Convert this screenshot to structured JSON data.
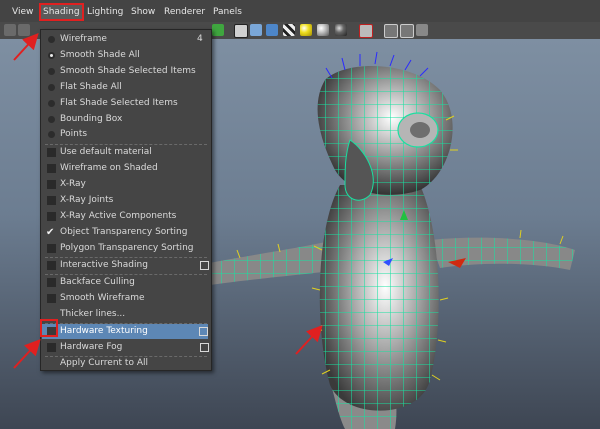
{
  "menubar": {
    "items": [
      "View",
      "Shading",
      "Lighting",
      "Show",
      "Renderer",
      "Panels"
    ]
  },
  "shading_menu": {
    "items": [
      {
        "label": "Wireframe",
        "shortcut": "4"
      },
      {
        "label": "Smooth Shade All"
      },
      {
        "label": "Smooth Shade Selected Items"
      },
      {
        "label": "Flat Shade All"
      },
      {
        "label": "Flat Shade Selected Items"
      },
      {
        "label": "Bounding Box"
      },
      {
        "label": "Points"
      },
      {
        "label": "Use default material"
      },
      {
        "label": "Wireframe on Shaded"
      },
      {
        "label": "X-Ray"
      },
      {
        "label": "X-Ray Joints"
      },
      {
        "label": "X-Ray Active Components"
      },
      {
        "label": "Object Transparency Sorting"
      },
      {
        "label": "Polygon Transparency Sorting"
      },
      {
        "label": "Interactive Shading"
      },
      {
        "label": "Backface Culling"
      },
      {
        "label": "Smooth Wireframe"
      },
      {
        "label": "Thicker lines..."
      },
      {
        "label": "Hardware Texturing"
      },
      {
        "label": "Hardware Fog"
      },
      {
        "label": "Apply Current to All"
      }
    ]
  },
  "colors": {
    "highlight": "#5d87b5",
    "annotation": "#e02020",
    "wireframe": "#19e0a0"
  }
}
